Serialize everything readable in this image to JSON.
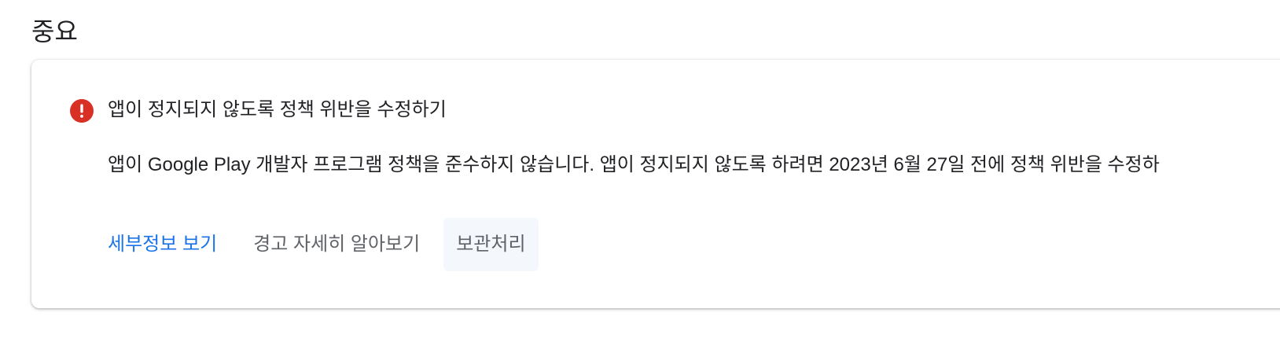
{
  "section": {
    "title": "중요"
  },
  "alert": {
    "icon": "error-exclamation-icon",
    "icon_color": "#d93025",
    "title": "앱이 정지되지 않도록 정책 위반을 수정하기",
    "body": "앱이 Google Play 개발자 프로그램 정책을 준수하지 않습니다. 앱이 정지되지 않도록 하려면 2023년 6월 27일 전에 정책 위반을 수정하"
  },
  "actions": {
    "view_details": "세부정보 보기",
    "learn_more": "경고 자세히 알아보기",
    "archive": "보관처리"
  },
  "colors": {
    "link_blue": "#1a73e8",
    "text_dark": "#202124",
    "text_muted": "#5f6368",
    "hover_bg": "#f4f8fd"
  }
}
